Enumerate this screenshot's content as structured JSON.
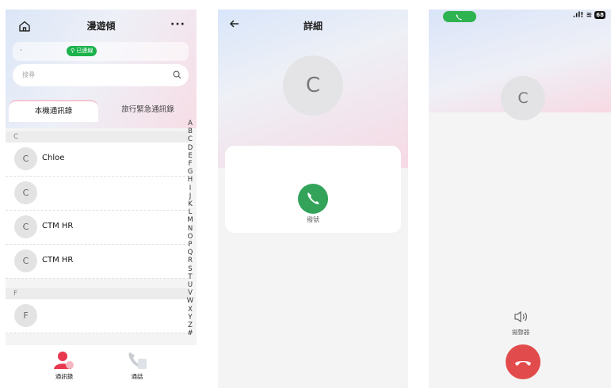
{
  "contacts_screen": {
    "title": "漫遊傾",
    "connection_status": "已連線",
    "search_placeholder": "搜尋",
    "tabs": [
      "本機通訊錄",
      "旅行緊急通訊錄"
    ],
    "sections": [
      {
        "letter": "C",
        "contacts": [
          {
            "initial": "C",
            "name": "Chloe"
          },
          {
            "initial": "C",
            "name": ""
          },
          {
            "initial": "C",
            "name": "CTM HR"
          },
          {
            "initial": "C",
            "name": "CTM HR"
          }
        ]
      },
      {
        "letter": "F",
        "contacts": [
          {
            "initial": "F",
            "name": ""
          }
        ]
      }
    ],
    "alphabet": [
      "A",
      "B",
      "C",
      "D",
      "E",
      "F",
      "G",
      "H",
      "I",
      "J",
      "K",
      "L",
      "M",
      "N",
      "O",
      "P",
      "Q",
      "R",
      "S",
      "T",
      "U",
      "V",
      "W",
      "X",
      "Y",
      "Z",
      "#"
    ],
    "nav": {
      "contacts_label": "通訊錄",
      "calls_label": "通話"
    },
    "colors": {
      "accent": "#e8374f",
      "connected": "#1bb24b"
    }
  },
  "detail_screen": {
    "title": "詳細",
    "avatar_initial": "C",
    "call_label": "撥號",
    "colors": {
      "call_button": "#33a35a"
    }
  },
  "call_screen": {
    "avatar_initial": "C",
    "battery": "68",
    "speaker_label": "揚聲器",
    "colors": {
      "hangup": "#e24b4b",
      "call_pill": "#2db34f"
    }
  }
}
